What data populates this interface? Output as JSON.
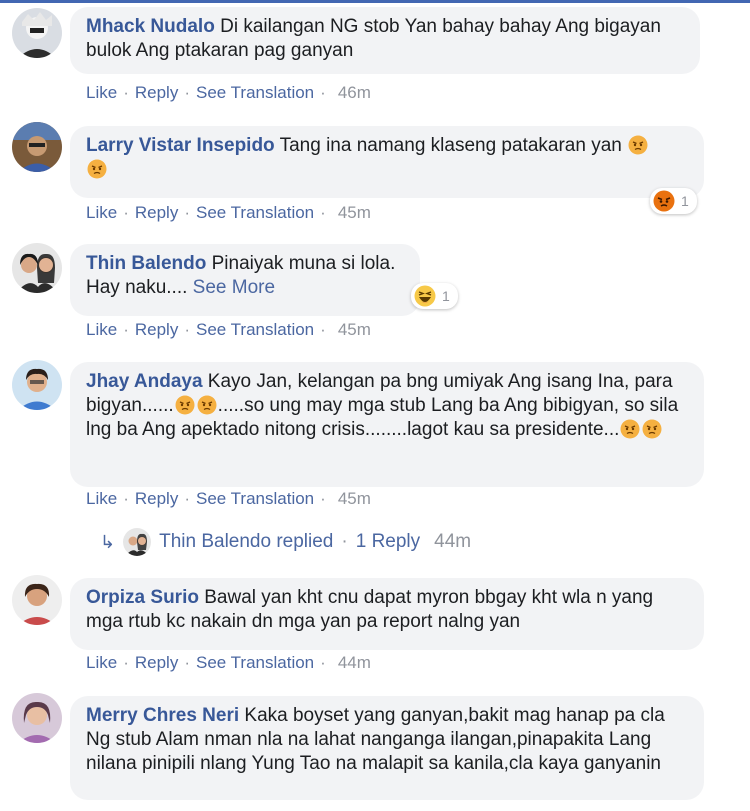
{
  "comments": [
    {
      "name": "Mhack Nudalo",
      "text": "Di kailangan NG stob Yan bahay bahay Ang bigayan bulok Ang ptakaran pag ganyan",
      "actions": {
        "like": "Like",
        "reply": "Reply",
        "translate": "See Translation",
        "time": "46m"
      }
    },
    {
      "name": "Larry Vistar Insepido",
      "text": "Tang ina namang klaseng patakaran yan",
      "emojis": [
        "angry-emoji",
        "angry-emoji"
      ],
      "reaction": {
        "icon": "angry-reaction-icon",
        "count": "1"
      },
      "actions": {
        "like": "Like",
        "reply": "Reply",
        "translate": "See Translation",
        "time": "45m"
      }
    },
    {
      "name": "Thin Balendo",
      "text_line1": "Pinaiyak muna si lola.",
      "text_line2": "Hay naku....",
      "see_more": "See More",
      "reaction": {
        "icon": "haha-reaction-icon",
        "count": "1"
      },
      "actions": {
        "like": "Like",
        "reply": "Reply",
        "translate": "See Translation",
        "time": "45m"
      }
    },
    {
      "name": "Jhay Andaya",
      "text_part1": "Kayo Jan, kelangan pa bng umiyak Ang isang Ina, para bigyan......",
      "text_part2": ".....so ung may mga stub Lang ba Ang bibigyan, so sila lng ba Ang apektado nitong crisis........lagot kau sa presidente...",
      "emojis": [
        "angry-emoji",
        "angry-emoji"
      ],
      "actions": {
        "like": "Like",
        "reply": "Reply",
        "translate": "See Translation",
        "time": "45m"
      },
      "replies": {
        "name": "Thin Balendo replied",
        "separator": "·",
        "count": "1 Reply",
        "time": "44m"
      }
    },
    {
      "name": "Orpiza Surio",
      "text": "Bawal yan kht cnu dapat myron bbgay kht wla n yang mga rtub kc nakain dn mga yan pa report nalng yan",
      "actions": {
        "like": "Like",
        "reply": "Reply",
        "translate": "See Translation",
        "time": "44m"
      }
    },
    {
      "name": "Merry Chres Neri",
      "text": "Kaka boyset yang ganyan,bakit mag hanap pa cla Ng stub Alam nman nla na lahat nanganga ilangan,pinapakita Lang nilana pinipili nlang Yung Tao na malapit sa kanila,cla kaya ganyanin"
    }
  ],
  "separator": "·",
  "colors": {
    "name": "#385898",
    "link": "#4b67a1",
    "muted": "#90949c",
    "bubble": "#f2f3f5",
    "topbar": "#4267b2"
  }
}
